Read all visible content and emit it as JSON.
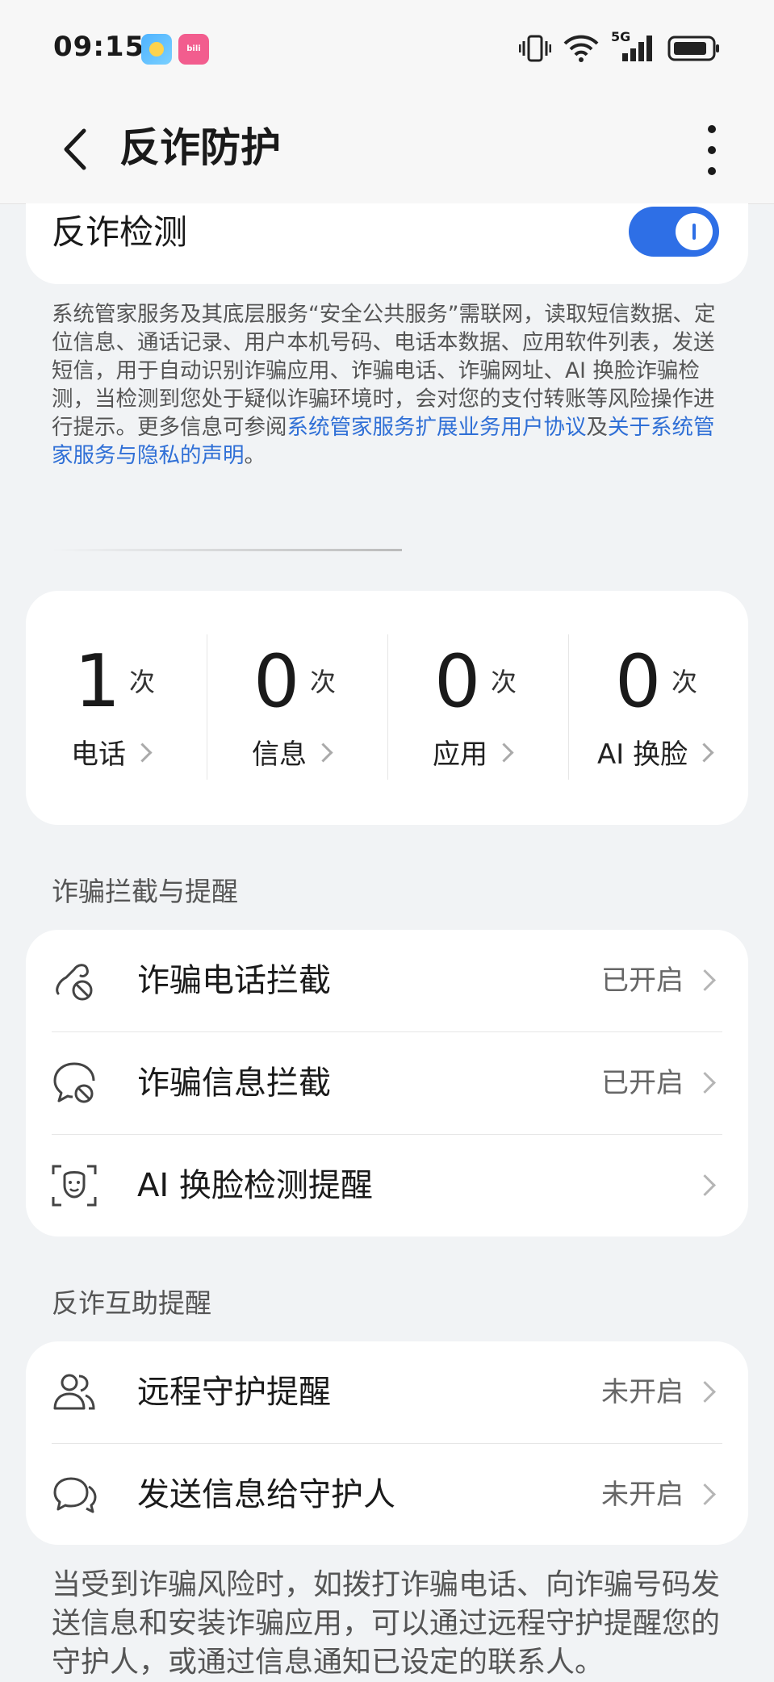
{
  "status_bar": {
    "time": "09:15",
    "network": "5G"
  },
  "header": {
    "title": "反诈防护"
  },
  "toggle": {
    "label": "反诈检测",
    "on": true
  },
  "description": {
    "text": "系统管家服务及其底层服务“安全公共服务”需联网，读取短信数据、定位信息、通话记录、用户本机号码、电话本数据、应用软件列表，发送短信，用于自动识别诈骗应用、诈骗电话、诈骗网址、AI 换脸诈骗检测，当检测到您处于疑似诈骗环境时，会对您的支付转账等风险操作进行提示。更多信息可参阅",
    "link1": "系统管家服务扩展业务用户协议",
    "joiner": "及",
    "link2": "关于系统管家服务与隐私的声明",
    "end": "。"
  },
  "stats": [
    {
      "value": "1",
      "unit": "次",
      "label": "电话"
    },
    {
      "value": "0",
      "unit": "次",
      "label": "信息"
    },
    {
      "value": "0",
      "unit": "次",
      "label": "应用"
    },
    {
      "value": "0",
      "unit": "次",
      "label": "AI 换脸"
    }
  ],
  "section1": {
    "title": "诈骗拦截与提醒",
    "items": [
      {
        "label": "诈骗电话拦截",
        "status": "已开启",
        "icon": "phone-block-icon"
      },
      {
        "label": "诈骗信息拦截",
        "status": "已开启",
        "icon": "message-block-icon"
      },
      {
        "label": "AI 换脸检测提醒",
        "status": "",
        "icon": "face-scan-icon"
      }
    ]
  },
  "section2": {
    "title": "反诈互助提醒",
    "items": [
      {
        "label": "远程守护提醒",
        "status": "未开启",
        "icon": "guardians-icon"
      },
      {
        "label": "发送信息给守护人",
        "status": "未开启",
        "icon": "chat-icon"
      }
    ]
  },
  "footer": {
    "text": "当受到诈骗风险时，如拨打诈骗电话、向诈骗号码发送信息和安装诈骗应用，可以通过远程守护提醒您的守护人，或通过信息通知已设定的联系人。"
  },
  "colors": {
    "accent": "#2e6fe6",
    "link": "#2f6fd6",
    "background": "#f1f3f5"
  }
}
